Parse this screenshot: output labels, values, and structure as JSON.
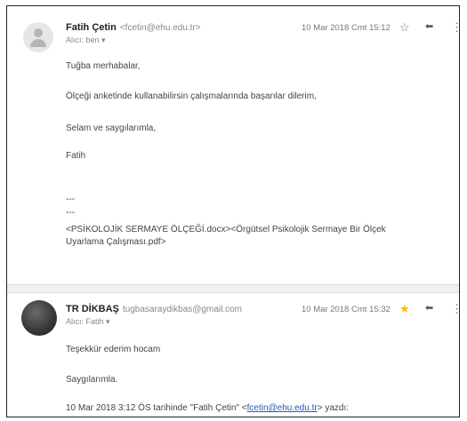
{
  "msg1": {
    "sender_name": "Fatih Çetin",
    "sender_email": "<fcetin@ehu.edu.tr>",
    "recipient": "Alıcı: ben ▾",
    "date": "10 Mar 2018 Cmt 15:12",
    "greeting": "Tuğba merhabalar,",
    "line1": "Ölçeği anketinde kullanabilirsin çalışmalarında başarılar dilerim,",
    "closing": "Selam ve saygılarımla,",
    "signature": "Fatih",
    "sep1": "---",
    "sep2": "---",
    "attachments": "<PSİKOLOJİK SERMAYE ÖLÇEĞİ.docx><Örgütsel Psikolojik Sermaye Bir Ölçek Uyarlama Çalışması.pdf>"
  },
  "msg2": {
    "sender_name": "TR DİKBAŞ",
    "sender_email": "tugbasaraydikbas@gmail.com",
    "recipient": "Alıcı: Fatih ▾",
    "date": "10 Mar 2018 Cmt 15:32",
    "line1": "Teşekkür ederim hocam",
    "closing": "Saygılarımla.",
    "quote_prefix": "10 Mar 2018 3:12 ÖS tarihinde \"Fatih Çetin\" <",
    "quote_link": "fcetin@ehu.edu.tr",
    "quote_suffix": "> yazdı:"
  },
  "icons": {
    "star_empty": "☆",
    "star_filled": "★",
    "reply": "⬅",
    "more": "⋮"
  }
}
